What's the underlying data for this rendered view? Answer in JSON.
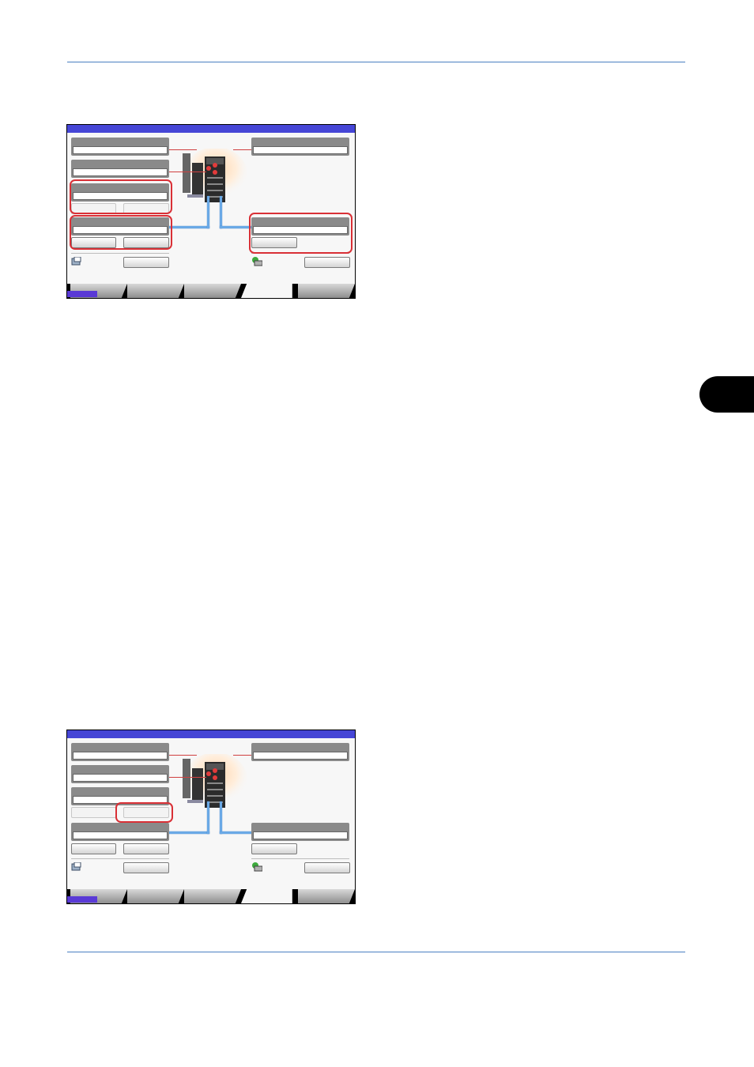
{
  "page": {
    "colors": {
      "rule": "#4a7fc1",
      "title_bar": "#4646d6",
      "highlight": "#d93036",
      "connector": "#6aa9e6"
    }
  },
  "screenshots": [
    {
      "highlighted_controls": [
        "paper-source-left-group",
        "paper-source-left-lower-group",
        "paper-source-right-group"
      ]
    },
    {
      "highlighted_controls": [
        "mp-tray-button-right"
      ]
    }
  ],
  "icons": {
    "left_bottom": "document-icon",
    "right_bottom": "globe-printer-icon",
    "machine": "printer-illustration"
  }
}
